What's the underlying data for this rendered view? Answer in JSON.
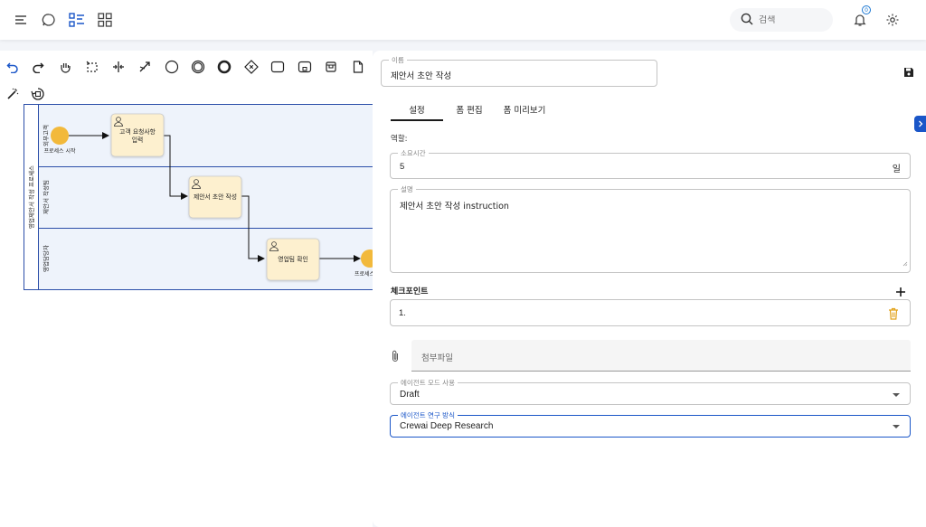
{
  "search": {
    "placeholder": "검색"
  },
  "notifications": {
    "count": "0"
  },
  "diagram": {
    "pool_title": "영업제안서 작성 프로세스",
    "lanes": [
      "외부고객",
      "제안서 작성팀",
      "영업담당자"
    ],
    "start_event_label": "프로세스 시작",
    "end_event_label": "프로세스 종료",
    "tasks": [
      {
        "label_line1": "고객 요청사항",
        "label_line2": "입력"
      },
      {
        "label_line1": "제안서 초안 작성",
        "label_line2": ""
      },
      {
        "label_line1": "영업팀 확인",
        "label_line2": ""
      }
    ]
  },
  "form": {
    "name_legend": "이름",
    "name_value": "제안서 초안 작성",
    "tabs": [
      "설정",
      "폼 편집",
      "폼 미리보기"
    ],
    "active_tab": "설정",
    "role_label": "역할:",
    "duration_legend": "소요시간",
    "duration_value": "5",
    "duration_unit": "일",
    "description_legend": "설명",
    "description_value": "제안서 초안 작성 instruction",
    "checkpoints_title": "체크포인트",
    "checkpoint_item": "1.",
    "attachment_placeholder": "첨부파일",
    "agent_mode_legend": "에이전트 모드 사용",
    "agent_mode_value": "Draft",
    "research_legend": "에이전트 연구 방식",
    "research_value": "Crewai Deep Research"
  },
  "colors": {
    "accent": "#1a56c8",
    "event_fill": "#f2b93b",
    "task_fill": "#fdf0cf",
    "lane_border": "#2b4ea8"
  }
}
